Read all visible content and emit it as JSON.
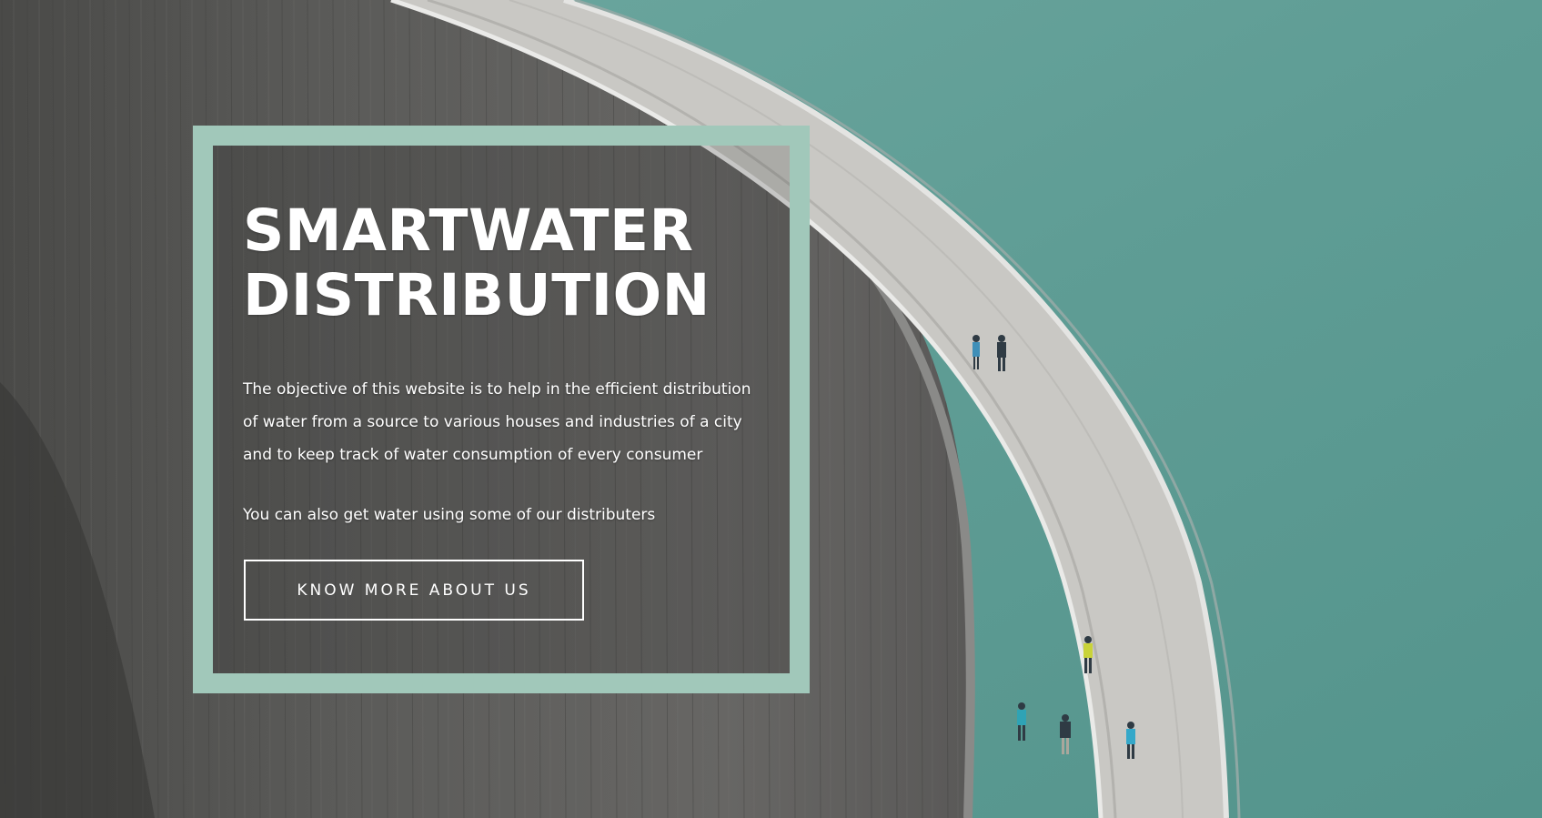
{
  "hero": {
    "title_line_1": "SMARTWATER",
    "title_line_2": "DISTRIBUTION",
    "description": "The objective of this website is to help in the efficient distribution of water from a source to various houses and industries of a city and to keep track of water consumption of every consumer",
    "subtext": "You can also get water using some of our distributers",
    "cta_label": "KNOW MORE ABOUT US"
  },
  "colors": {
    "frame": "#a1c8ba",
    "water": "#5f9c95",
    "concrete": "#5a5a58",
    "text": "#ffffff"
  },
  "background": {
    "image": "dam-walkway-photo"
  }
}
